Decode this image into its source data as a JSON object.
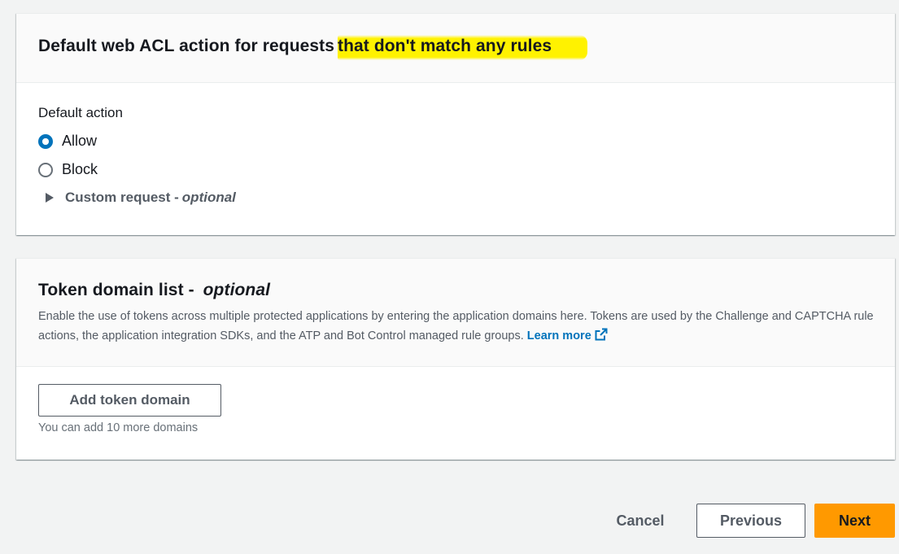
{
  "default_action_panel": {
    "title_plain": "Default web ACL action for requests ",
    "title_highlighted": "that don't match any rules",
    "field_label": "Default action",
    "options": [
      {
        "label": "Allow",
        "selected": true
      },
      {
        "label": "Block",
        "selected": false
      }
    ],
    "custom_request": {
      "label": "Custom request - ",
      "optional": "optional"
    }
  },
  "token_domain_panel": {
    "title": "Token domain list - ",
    "title_optional": "optional",
    "description": "Enable the use of tokens across multiple protected applications by entering the application domains here. Tokens are used by the Challenge and CAPTCHA rule actions, the application integration SDKs, and the ATP and Bot Control managed rule groups.",
    "learn_more": "Learn more",
    "add_button": "Add token domain",
    "hint": "You can add 10 more domains"
  },
  "footer": {
    "cancel": "Cancel",
    "previous": "Previous",
    "next": "Next"
  },
  "colors": {
    "accent": "#0073bb",
    "primary_button": "#ff9900",
    "highlight": "#fff200"
  }
}
